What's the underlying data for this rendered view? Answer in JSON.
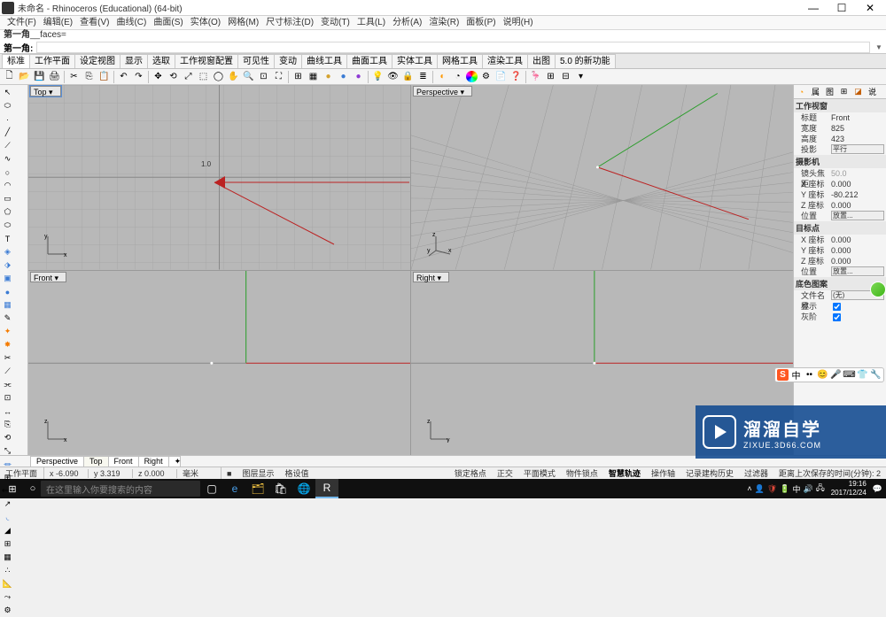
{
  "window": {
    "title": "未命名 - Rhinoceros (Educational) (64-bit)",
    "min": "—",
    "max": "☐",
    "close": "✕"
  },
  "menus": [
    "文件(F)",
    "编辑(E)",
    "查看(V)",
    "曲线(C)",
    "曲面(S)",
    "实体(O)",
    "网格(M)",
    "尺寸标注(D)",
    "变动(T)",
    "工具(L)",
    "分析(A)",
    "渲染(R)",
    "面板(P)",
    "说明(H)"
  ],
  "cmdline": {
    "l1": "第一角",
    "l1b": "__faces=",
    "l2": "第一角:"
  },
  "tooltabs": [
    "标准",
    "工作平面",
    "设定视图",
    "显示",
    "选取",
    "工作视窗配置",
    "可见性",
    "变动",
    "曲线工具",
    "曲面工具",
    "实体工具",
    "网格工具",
    "渲染工具",
    "出图",
    "5.0 的新功能"
  ],
  "viewports": {
    "top": "Top ▾",
    "persp": "Perspective ▾",
    "front": "Front ▾",
    "right": "Right ▾",
    "cursor": "1.0"
  },
  "viewtabs": [
    "Perspective",
    "Top",
    "Front",
    "Right",
    "✦"
  ],
  "rpanel": {
    "tabs": [
      "◔",
      "属",
      "图",
      "⊞",
      "◪",
      "说"
    ],
    "sec1": "工作视窗",
    "r_title_k": "标题",
    "r_title_v": "Front",
    "r_w_k": "宽度",
    "r_w_v": "825",
    "r_h_k": "高度",
    "r_h_v": "423",
    "r_proj_k": "投影",
    "r_proj_v": "平行",
    "sec2": "摄影机",
    "r_lens_k": "镜头焦距",
    "r_lens_v": "50.0",
    "r_x_k": "X 座标",
    "r_x_v": "0.000",
    "r_y_k": "Y 座标",
    "r_y_v": "-80.212",
    "r_z_k": "Z 座标",
    "r_z_v": "0.000",
    "r_pos_k": "位置",
    "r_pos_v": "放置...",
    "sec3": "目标点",
    "r_tx_k": "X 座标",
    "r_tx_v": "0.000",
    "r_ty_k": "Y 座标",
    "r_ty_v": "0.000",
    "r_tz_k": "Z 座标",
    "r_tz_v": "0.000",
    "r_tpos_k": "位置",
    "r_tpos_v": "放置...",
    "sec4": "底色图案",
    "r_fn_k": "文件名称",
    "r_fn_v": "(无)",
    "r_show_k": "显示",
    "r_gray_k": "灰阶"
  },
  "status": {
    "plane": "工作平面",
    "x": "x -6.090",
    "y": "y 3.319",
    "z": "z 0.000",
    "unit": "毫米",
    "items": [
      "图层显示",
      "格设值",
      "锁定格点",
      "正交",
      "平面模式",
      "物件锁点",
      "智慧轨迹",
      "操作轴",
      "记录建构历史",
      "过滤器"
    ],
    "right": "距离上次保存的时间(分钟): 2"
  },
  "taskbar": {
    "search": "在这里输入你要搜索的内容",
    "clock_t": "19:16",
    "clock_d": "2017/12/24"
  },
  "watermark": {
    "txt": "溜溜自学",
    "sub": "ZIXUE.3D66.COM"
  }
}
